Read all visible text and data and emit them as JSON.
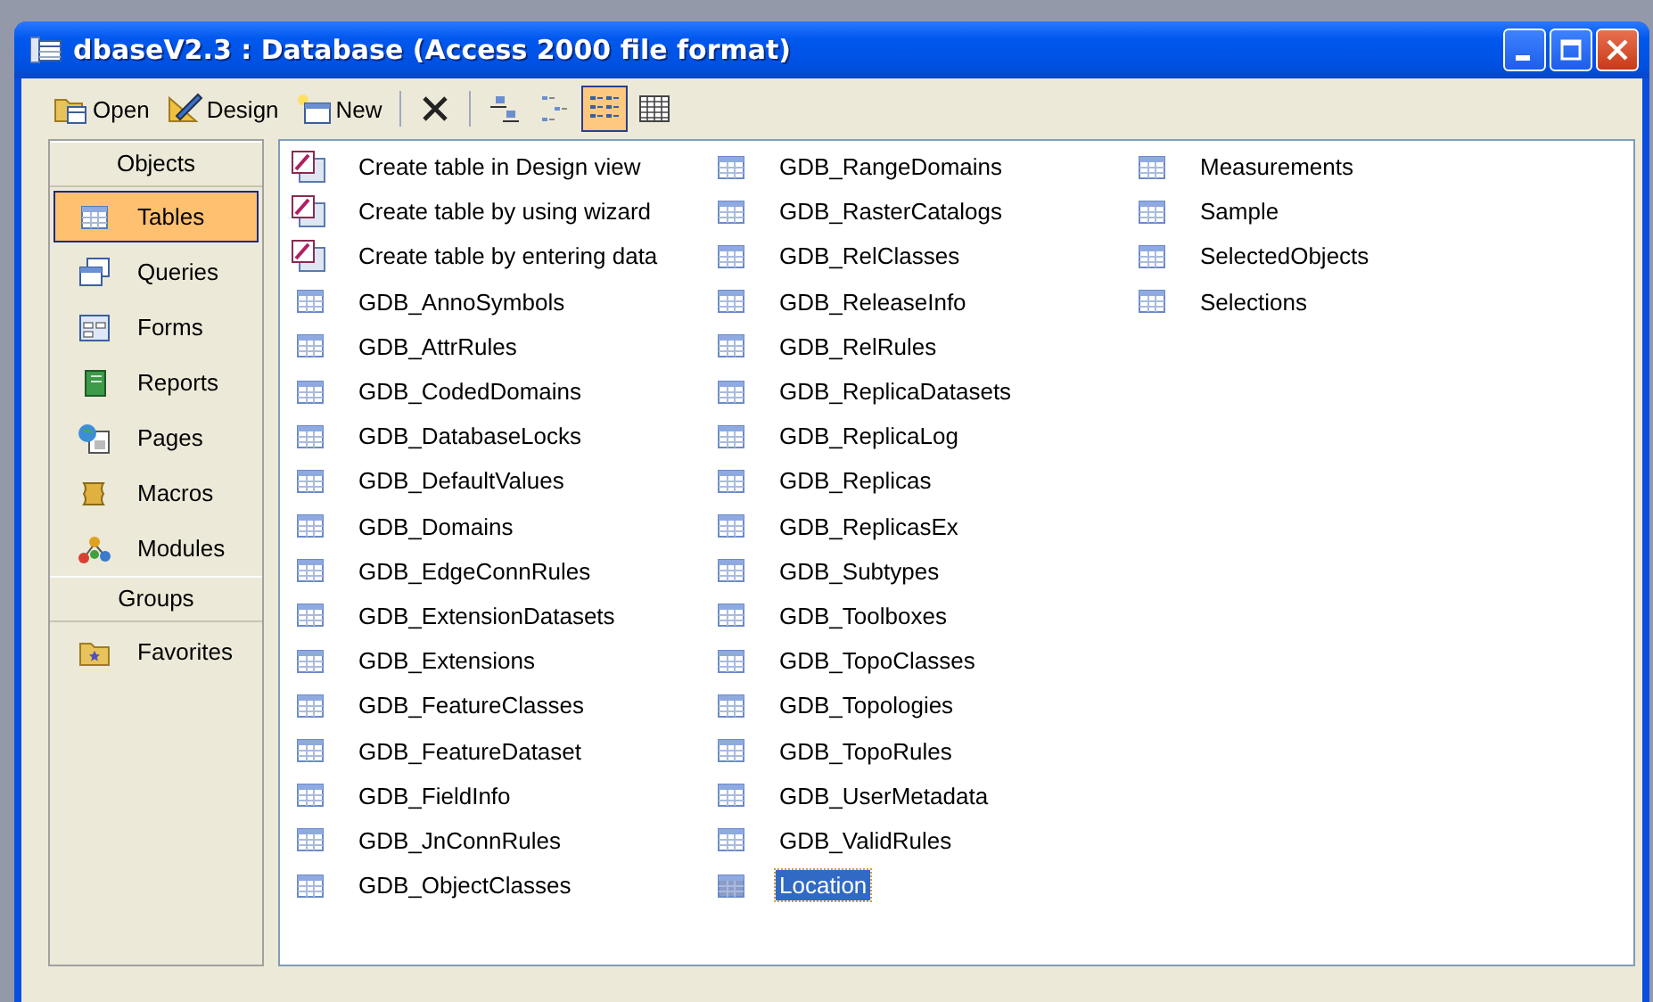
{
  "window": {
    "title": "dbaseV2.3 : Database (Access 2000 file format)"
  },
  "toolbar": [
    {
      "kind": "open",
      "label": "Open"
    },
    {
      "kind": "design",
      "label": "Design"
    },
    {
      "kind": "new",
      "label": "New"
    },
    {
      "kind": "separator"
    },
    {
      "kind": "delete",
      "selected": false
    },
    {
      "kind": "separator"
    },
    {
      "kind": "large-icons",
      "selected": false
    },
    {
      "kind": "small-icons",
      "selected": false
    },
    {
      "kind": "list",
      "selected": true
    },
    {
      "kind": "details",
      "selected": false
    }
  ],
  "sidebar": [
    {
      "kind": "header",
      "label": "Objects"
    },
    {
      "kind": "tables",
      "label": "Tables",
      "selected": true
    },
    {
      "kind": "queries",
      "label": "Queries",
      "selected": false
    },
    {
      "kind": "forms",
      "label": "Forms",
      "selected": false
    },
    {
      "kind": "reports",
      "label": "Reports",
      "selected": false
    },
    {
      "kind": "pages",
      "label": "Pages",
      "selected": false
    },
    {
      "kind": "macros",
      "label": "Macros",
      "selected": false
    },
    {
      "kind": "modules",
      "label": "Modules",
      "selected": false
    },
    {
      "kind": "header",
      "label": "Groups"
    },
    {
      "kind": "favorites",
      "label": "Favorites",
      "selected": false
    }
  ],
  "items": [
    {
      "kind": "shortcut",
      "label": "Create table in Design view",
      "selected": false
    },
    {
      "kind": "shortcut",
      "label": "Create table by using wizard",
      "selected": false
    },
    {
      "kind": "shortcut",
      "label": "Create table by entering data",
      "selected": false
    },
    {
      "kind": "table",
      "label": "GDB_AnnoSymbols",
      "selected": false
    },
    {
      "kind": "table",
      "label": "GDB_AttrRules",
      "selected": false
    },
    {
      "kind": "table",
      "label": "GDB_CodedDomains",
      "selected": false
    },
    {
      "kind": "table",
      "label": "GDB_DatabaseLocks",
      "selected": false
    },
    {
      "kind": "table",
      "label": "GDB_DefaultValues",
      "selected": false
    },
    {
      "kind": "table",
      "label": "GDB_Domains",
      "selected": false
    },
    {
      "kind": "table",
      "label": "GDB_EdgeConnRules",
      "selected": false
    },
    {
      "kind": "table",
      "label": "GDB_ExtensionDatasets",
      "selected": false
    },
    {
      "kind": "table",
      "label": "GDB_Extensions",
      "selected": false
    },
    {
      "kind": "table",
      "label": "GDB_FeatureClasses",
      "selected": false
    },
    {
      "kind": "table",
      "label": "GDB_FeatureDataset",
      "selected": false
    },
    {
      "kind": "table",
      "label": "GDB_FieldInfo",
      "selected": false
    },
    {
      "kind": "table",
      "label": "GDB_JnConnRules",
      "selected": false
    },
    {
      "kind": "table",
      "label": "GDB_ObjectClasses",
      "selected": false
    },
    {
      "kind": "table",
      "label": "GDB_RangeDomains",
      "selected": false
    },
    {
      "kind": "table",
      "label": "GDB_RasterCatalogs",
      "selected": false
    },
    {
      "kind": "table",
      "label": "GDB_RelClasses",
      "selected": false
    },
    {
      "kind": "table",
      "label": "GDB_ReleaseInfo",
      "selected": false
    },
    {
      "kind": "table",
      "label": "GDB_RelRules",
      "selected": false
    },
    {
      "kind": "table",
      "label": "GDB_ReplicaDatasets",
      "selected": false
    },
    {
      "kind": "table",
      "label": "GDB_ReplicaLog",
      "selected": false
    },
    {
      "kind": "table",
      "label": "GDB_Replicas",
      "selected": false
    },
    {
      "kind": "table",
      "label": "GDB_ReplicasEx",
      "selected": false
    },
    {
      "kind": "table",
      "label": "GDB_Subtypes",
      "selected": false
    },
    {
      "kind": "table",
      "label": "GDB_Toolboxes",
      "selected": false
    },
    {
      "kind": "table",
      "label": "GDB_TopoClasses",
      "selected": false
    },
    {
      "kind": "table",
      "label": "GDB_Topologies",
      "selected": false
    },
    {
      "kind": "table",
      "label": "GDB_TopoRules",
      "selected": false
    },
    {
      "kind": "table",
      "label": "GDB_UserMetadata",
      "selected": false
    },
    {
      "kind": "table",
      "label": "GDB_ValidRules",
      "selected": false
    },
    {
      "kind": "table",
      "label": "Location",
      "selected": true
    },
    {
      "kind": "table",
      "label": "Measurements",
      "selected": false
    },
    {
      "kind": "table",
      "label": "Sample",
      "selected": false
    },
    {
      "kind": "table",
      "label": "SelectedObjects",
      "selected": false
    },
    {
      "kind": "table",
      "label": "Selections",
      "selected": false
    }
  ]
}
